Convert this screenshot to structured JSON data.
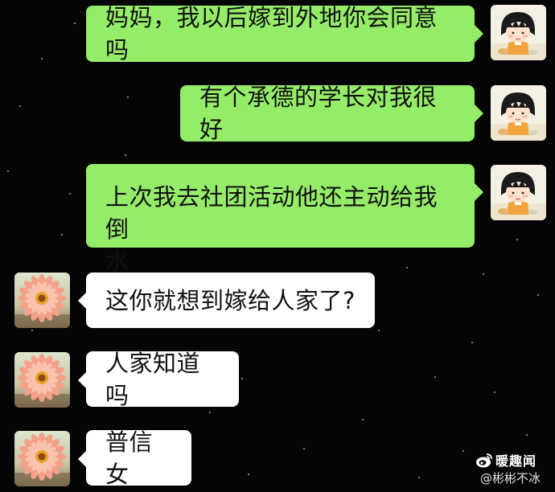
{
  "chat": {
    "messages": [
      {
        "sender": "self",
        "text": "妈妈，我以后嫁到外地你会同意吗",
        "avatar": "girl-avatar-icon"
      },
      {
        "sender": "self",
        "text": "有个承德的学长对我很好",
        "avatar": "girl-avatar-icon"
      },
      {
        "sender": "self",
        "lines": [
          "上次我去社团活动他还主动给我倒",
          "水"
        ],
        "avatar": "girl-avatar-icon"
      },
      {
        "sender": "mom",
        "text": "这你就想到嫁给人家了?",
        "avatar": "flower-avatar-icon"
      },
      {
        "sender": "mom",
        "text": "人家知道吗",
        "avatar": "flower-avatar-icon"
      },
      {
        "sender": "mom",
        "text": "普信女",
        "avatar": "flower-avatar-icon"
      }
    ]
  },
  "watermark": {
    "brand": "暖趣闻",
    "user": "@彬彬不冰"
  },
  "colors": {
    "background": "#050505",
    "sent_bubble": "#95ec69",
    "received_bubble": "#ffffff",
    "text": "#111111"
  }
}
